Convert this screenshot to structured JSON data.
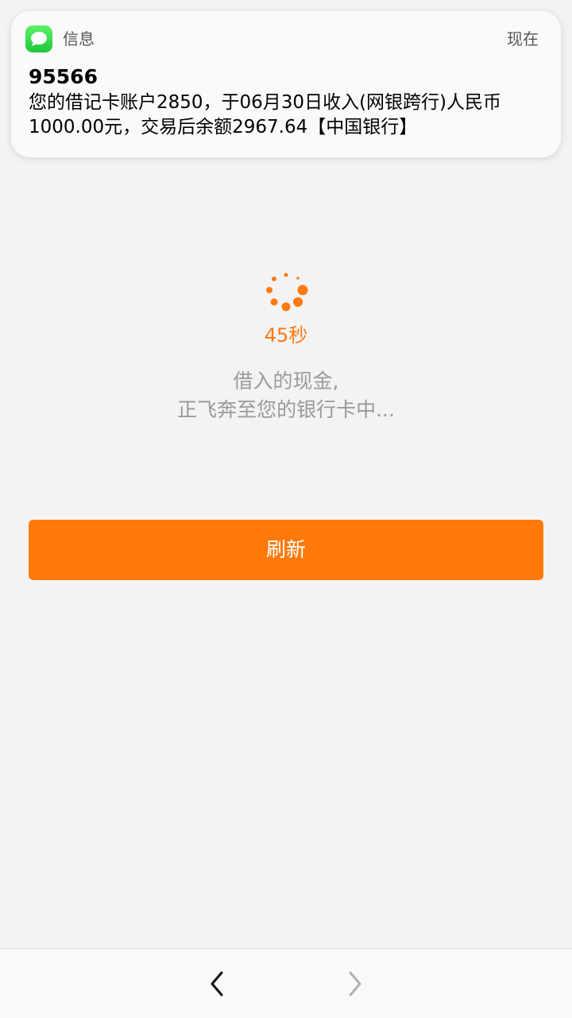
{
  "notification": {
    "app_name": "信息",
    "time": "现在",
    "sender": "95566",
    "body": "您的借记卡账户2850，于06月30日收入(网银跨行)人民币1000.00元，交易后余额2967.64【中国银行】",
    "icon": "messages-icon"
  },
  "loading": {
    "countdown": "45秒",
    "message_line1": "借入的现金,",
    "message_line2": "正飞奔至您的银行卡中...",
    "accent_color": "#ff7a0a"
  },
  "actions": {
    "refresh_label": "刷新"
  },
  "nav": {
    "back_icon": "chevron-left-icon",
    "forward_icon": "chevron-right-icon"
  }
}
